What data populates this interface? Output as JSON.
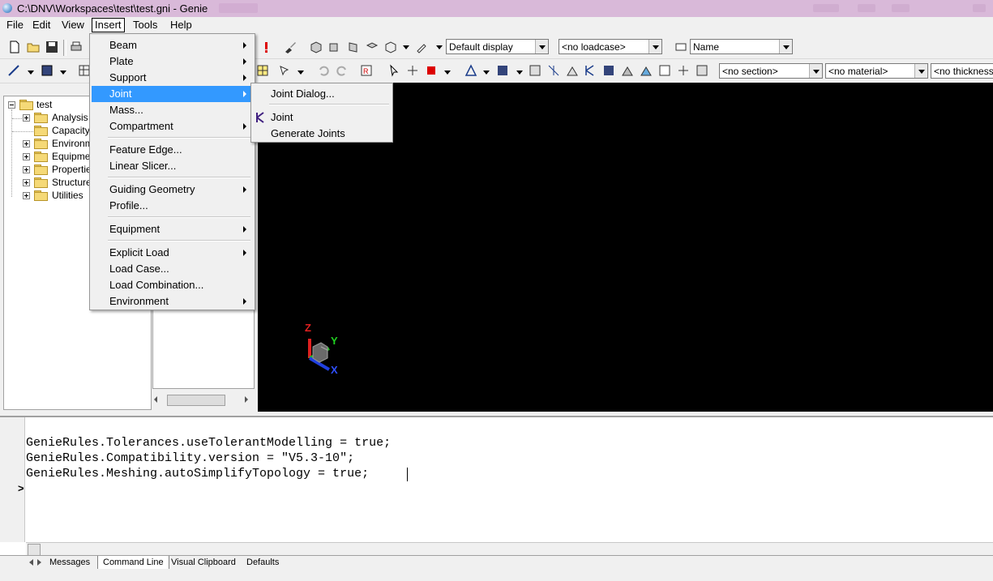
{
  "window": {
    "title": "C:\\DNV\\Workspaces\\test\\test.gni - Genie"
  },
  "menubar": {
    "items": [
      "File",
      "Edit",
      "View",
      "Insert",
      "Tools",
      "Help"
    ],
    "active": "Insert"
  },
  "toolbar1": {
    "display_combo": "Default display",
    "loadcase_combo": "<no loadcase>",
    "name_combo": "Name"
  },
  "toolbar2": {
    "section_combo": "<no section>",
    "material_combo": "<no material>",
    "thickness_combo": "<no thickness"
  },
  "tree": {
    "root": "test",
    "children": [
      "Analysis",
      "Capacity",
      "Environme",
      "Equipmer",
      "Properties",
      "Structure",
      "Utilities"
    ]
  },
  "insert_menu": {
    "items": [
      {
        "label": "Beam",
        "submenu": true
      },
      {
        "label": "Plate",
        "submenu": true
      },
      {
        "label": "Support",
        "submenu": true
      },
      {
        "label": "Joint",
        "submenu": true,
        "highlighted": true
      },
      {
        "label": "Mass...",
        "submenu": false
      },
      {
        "label": "Compartment",
        "submenu": true
      },
      {
        "label": "Feature Edge...",
        "submenu": false
      },
      {
        "label": "Linear Slicer...",
        "submenu": false
      },
      {
        "label": "Guiding Geometry",
        "submenu": true
      },
      {
        "label": "Profile...",
        "submenu": false
      },
      {
        "label": "Equipment",
        "submenu": true
      },
      {
        "label": "Explicit Load",
        "submenu": true
      },
      {
        "label": "Load Case...",
        "submenu": false
      },
      {
        "label": "Load Combination...",
        "submenu": false
      },
      {
        "label": "Environment",
        "submenu": true
      }
    ]
  },
  "joint_submenu": {
    "items": [
      {
        "label": "Joint Dialog...",
        "icon": null
      },
      {
        "label": "Joint",
        "icon": "joint-k-icon"
      },
      {
        "label": "Generate Joints",
        "icon": null
      }
    ]
  },
  "viewport": {
    "axes": [
      "Z",
      "Y",
      "X"
    ]
  },
  "console": {
    "lines": [
      "GenieRules.Tolerances.useTolerantModelling = true;",
      "GenieRules.Compatibility.version = \"V5.3-10\";",
      "GenieRules.Meshing.autoSimplifyTopology = true;"
    ],
    "prompt": ">",
    "tabs": [
      "Messages",
      "Command Line",
      "Visual Clipboard",
      "Defaults"
    ],
    "active_tab": "Command Line"
  },
  "colors": {
    "highlight": "#3399ff",
    "titlebar": "#d9b9d9",
    "viewport_bg": "#000000"
  }
}
